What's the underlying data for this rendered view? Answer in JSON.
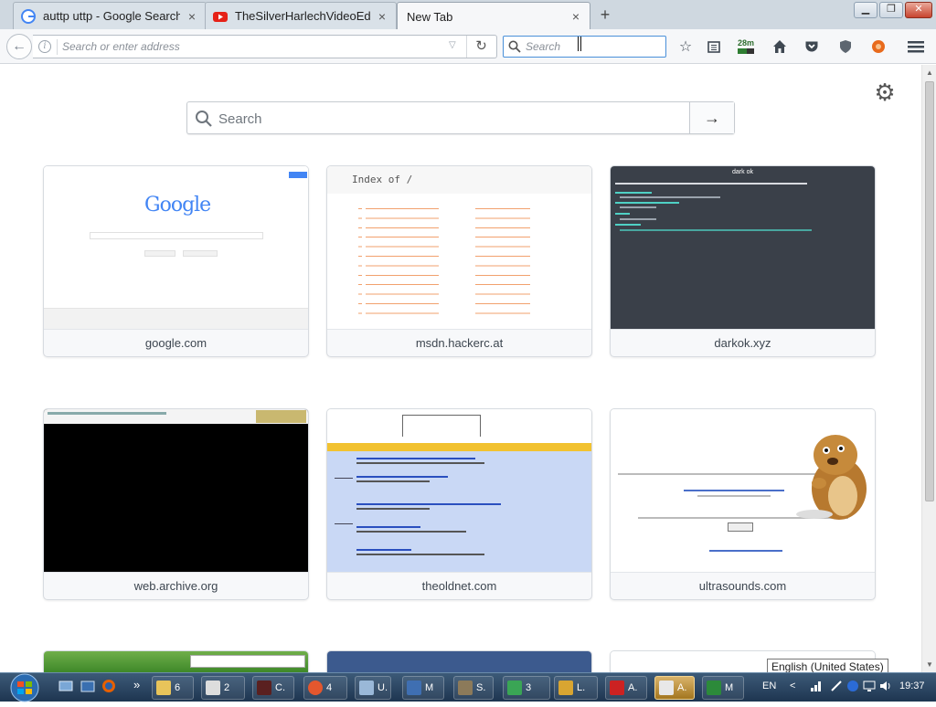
{
  "tabs": [
    {
      "label": "auttp uttp - Google Search",
      "icon": "google-icon",
      "close": "×"
    },
    {
      "label": "TheSilverHarlechVideoEdit...",
      "icon": "youtube-icon",
      "close": "×"
    },
    {
      "label": "New Tab",
      "close": "×"
    }
  ],
  "new_tab_symbol": "+",
  "window_controls": {
    "minimize": "▁",
    "restore": "❐",
    "close": "✕"
  },
  "navbar": {
    "url_placeholder": "Search or enter address",
    "search_placeholder": "Search",
    "info_glyph": "i",
    "dropmarker_glyph": "▽",
    "reload_glyph": "↻",
    "back_glyph": "←",
    "badge_text": "28m"
  },
  "newtab": {
    "search_placeholder": "Search",
    "go_glyph": "→",
    "gear_glyph": "⚙"
  },
  "tiles": [
    {
      "label": "google.com",
      "thumb": "google"
    },
    {
      "label": "msdn.hackerc.at",
      "thumb": "index",
      "index_title": "Index of /"
    },
    {
      "label": "darkok.xyz",
      "thumb": "dark",
      "dark_title": "dark ok"
    },
    {
      "label": "web.archive.org",
      "thumb": "black"
    },
    {
      "label": "theoldnet.com",
      "thumb": "oldnet"
    },
    {
      "label": "ultrasounds.com",
      "thumb": "ultra"
    }
  ],
  "google_logo": "Google",
  "taskbar": {
    "buttons": [
      {
        "label": "6",
        "color": "#e8c45a"
      },
      {
        "label": "2",
        "color": "#dddddd"
      },
      {
        "label": "C.",
        "color": "#5a2020"
      },
      {
        "label": "4",
        "color": "#e4572e"
      },
      {
        "label": "U.",
        "color": "#9ab8d8"
      },
      {
        "label": "M",
        "color": "#3f6fb2"
      },
      {
        "label": "S.",
        "color": "#8c7a5a"
      },
      {
        "label": "3",
        "color": "#3aa555"
      },
      {
        "label": "L.",
        "color": "#d9a531"
      },
      {
        "label": "A.",
        "color": "#cc2222"
      },
      {
        "label": "A.",
        "color": "#e8e8e8"
      },
      {
        "label": "M",
        "color": "#2c8a3a"
      }
    ],
    "lang": "EN",
    "time": "19:37",
    "overflow": "»",
    "tray_arrow": "<"
  },
  "tooltip": "English (United States)",
  "colors": {
    "accent": "#4a90d9",
    "dark_tile": "#3a4049",
    "oldnet_blue": "#c9d8f5",
    "oldnet_bar": "#f2c230"
  }
}
